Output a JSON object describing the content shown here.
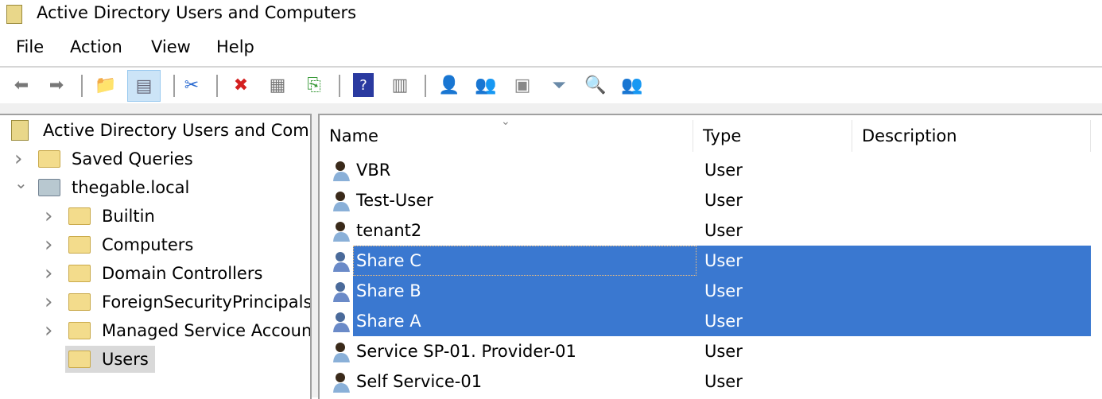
{
  "window": {
    "title": "Active Directory Users and Computers"
  },
  "menu": [
    "File",
    "Action",
    "View",
    "Help"
  ],
  "toolbar": {
    "icons": [
      "back-icon",
      "forward-icon",
      "up-folder-icon",
      "show-console-tree-icon",
      "cut-icon",
      "delete-icon",
      "properties-icon",
      "export-list-icon",
      "help-icon",
      "show-action-pane-icon",
      "new-user-icon",
      "new-group-icon",
      "new-ou-icon",
      "filter-icon",
      "find-icon",
      "add-to-group-icon"
    ]
  },
  "tree": {
    "root": "Active Directory Users and Com",
    "items": [
      {
        "label": "Saved Queries",
        "level": 1,
        "expanded": false
      },
      {
        "label": "thegable.local",
        "level": 1,
        "expanded": true
      },
      {
        "label": "Builtin",
        "level": 2,
        "expanded": false
      },
      {
        "label": "Computers",
        "level": 2,
        "expanded": false
      },
      {
        "label": "Domain Controllers",
        "level": 2,
        "expanded": false
      },
      {
        "label": "ForeignSecurityPrincipals",
        "level": 2,
        "expanded": false
      },
      {
        "label": "Managed Service Accounts",
        "level": 2,
        "expanded": false
      },
      {
        "label": "Users",
        "level": 2,
        "selected": true
      }
    ]
  },
  "list": {
    "columns": [
      "Name",
      "Type",
      "Description"
    ],
    "rows": [
      {
        "name": "VBR",
        "type": "User",
        "selected": false
      },
      {
        "name": "Test-User",
        "type": "User",
        "selected": false
      },
      {
        "name": "tenant2",
        "type": "User",
        "selected": false
      },
      {
        "name": "Share C",
        "type": "User",
        "selected": true
      },
      {
        "name": "Share B",
        "type": "User",
        "selected": true
      },
      {
        "name": "Share A",
        "type": "User",
        "selected": true
      },
      {
        "name": "Service SP-01. Provider-01",
        "type": "User",
        "selected": false
      },
      {
        "name": "Self Service-01",
        "type": "User",
        "selected": false
      }
    ]
  },
  "colors": {
    "selection": "#3a78d0"
  }
}
